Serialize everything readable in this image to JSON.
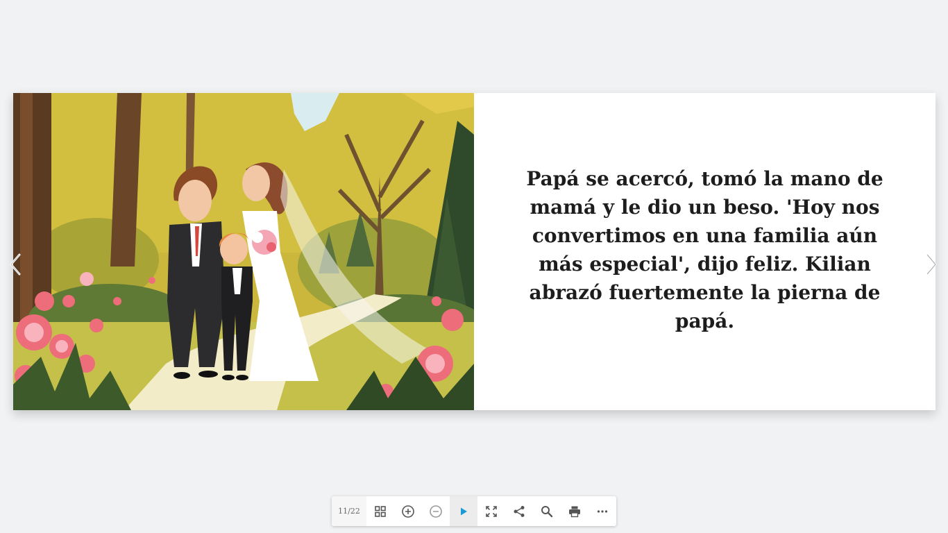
{
  "story": {
    "text": "Papá se acercó, tomó la mano de mamá y le dio un beso. 'Hoy nos convertimos en una familia aún más especial', dijo feliz. Kilian abrazó fuertemente la pierna de papá."
  },
  "illustration": {
    "subject": "wedding-scene-illustration"
  },
  "navigation": {
    "prev_icon": "chevron-left-icon",
    "next_icon": "chevron-right-icon"
  },
  "toolbar": {
    "page_counter": "11/22",
    "buttons": [
      {
        "icon": "grid-icon"
      },
      {
        "icon": "zoom-in-icon"
      },
      {
        "icon": "zoom-out-icon"
      },
      {
        "icon": "play-icon",
        "active": true
      },
      {
        "icon": "fullscreen-icon"
      },
      {
        "icon": "share-icon"
      },
      {
        "icon": "search-icon"
      },
      {
        "icon": "print-icon"
      },
      {
        "icon": "more-icon"
      }
    ]
  },
  "colors": {
    "background": "#f1f2f4",
    "accent": "#1a9bd7",
    "text": "#1d1d1d",
    "icon": "#555555"
  }
}
